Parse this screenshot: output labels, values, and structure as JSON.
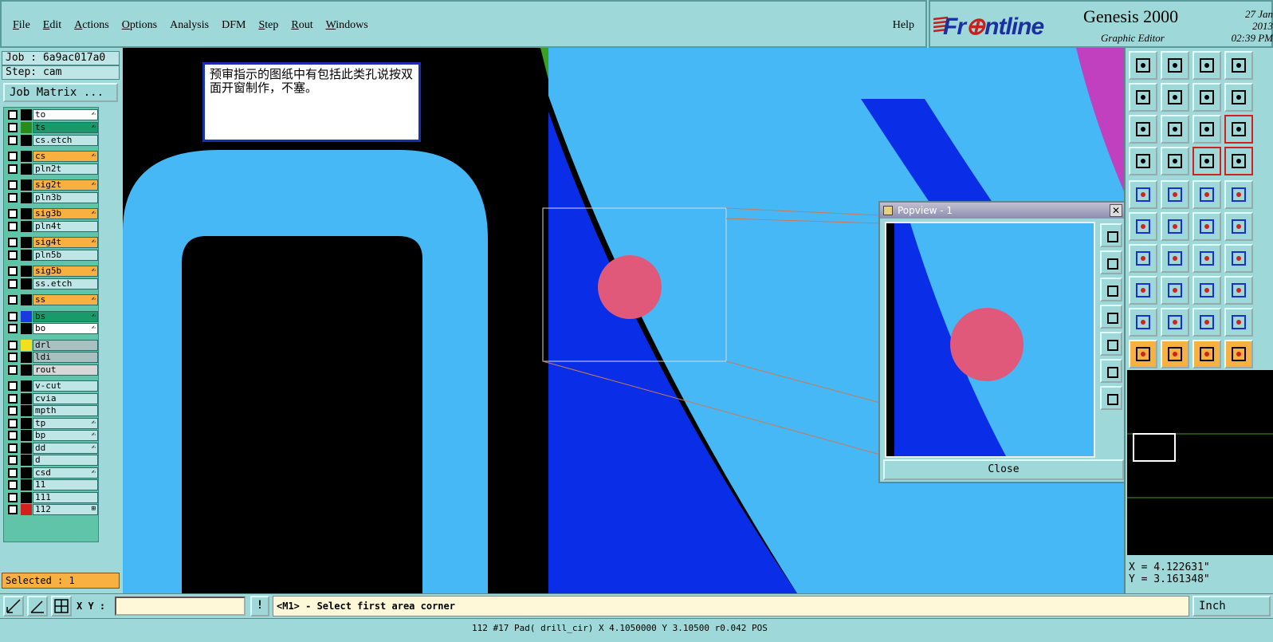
{
  "menu": {
    "items": [
      {
        "label": "File",
        "mnemonic": "F"
      },
      {
        "label": "Edit",
        "mnemonic": "E"
      },
      {
        "label": "Actions",
        "mnemonic": "A"
      },
      {
        "label": "Options",
        "mnemonic": "O"
      },
      {
        "label": "Analysis",
        "mnemonic": "A"
      },
      {
        "label": "DFM",
        "mnemonic": "D"
      },
      {
        "label": "Step",
        "mnemonic": "S"
      },
      {
        "label": "Rout",
        "mnemonic": "R"
      },
      {
        "label": "Windows",
        "mnemonic": "W"
      }
    ],
    "help": "Help"
  },
  "brand": {
    "logo_text_pre": "Fr",
    "logo_text_post": "ntline",
    "product": "Genesis 2000",
    "subtitle": "Graphic Editor",
    "date": "27 Jan 2013",
    "time": "02:39 PM"
  },
  "job": {
    "job_line": "Job : 6a9ac017a0",
    "step_line": "Step: cam",
    "job_matrix_button": "Job Matrix ..."
  },
  "layers": [
    {
      "name": "to",
      "style": "white",
      "color": "#000000",
      "mark": "✍"
    },
    {
      "name": "ts",
      "style": "green",
      "color": "#2a8a1a",
      "mark": "✍"
    },
    {
      "name": "cs.etch",
      "style": "plain",
      "color": "#000000",
      "mark": ""
    },
    {
      "name": "cs",
      "style": "orange",
      "color": "#000000",
      "mark": "✍"
    },
    {
      "name": "pln2t",
      "style": "plain",
      "color": "#000000",
      "mark": ""
    },
    {
      "name": "sig2t",
      "style": "orange",
      "color": "#000000",
      "mark": "✍"
    },
    {
      "name": "pln3b",
      "style": "plain",
      "color": "#000000",
      "mark": ""
    },
    {
      "name": "sig3b",
      "style": "orange",
      "color": "#000000",
      "mark": "✍"
    },
    {
      "name": "pln4t",
      "style": "plain",
      "color": "#000000",
      "mark": ""
    },
    {
      "name": "sig4t",
      "style": "orange",
      "color": "#000000",
      "mark": "✍"
    },
    {
      "name": "pln5b",
      "style": "plain",
      "color": "#000000",
      "mark": ""
    },
    {
      "name": "sig5b",
      "style": "orange",
      "color": "#000000",
      "mark": "✍"
    },
    {
      "name": "ss.etch",
      "style": "plain",
      "color": "#000000",
      "mark": ""
    },
    {
      "name": "ss",
      "style": "orange",
      "color": "#000000",
      "mark": "✍"
    },
    {
      "name": "bs",
      "style": "green",
      "color": "#1a3ae0",
      "mark": "✍"
    },
    {
      "name": "bo",
      "style": "white",
      "color": "#000000",
      "mark": "✍"
    },
    {
      "name": "drl",
      "style": "gray",
      "color": "#f0e020",
      "mark": ""
    },
    {
      "name": "ldi",
      "style": "gray",
      "color": "#000000",
      "mark": ""
    },
    {
      "name": "rout",
      "style": "lgray",
      "color": "#000000",
      "mark": ""
    },
    {
      "name": "v-cut",
      "style": "plain",
      "color": "#000000",
      "mark": ""
    },
    {
      "name": "cvia",
      "style": "plain",
      "color": "#000000",
      "mark": ""
    },
    {
      "name": "mpth",
      "style": "plain",
      "color": "#000000",
      "mark": ""
    },
    {
      "name": "tp",
      "style": "plain",
      "color": "#000000",
      "mark": "✍"
    },
    {
      "name": "bp",
      "style": "plain",
      "color": "#000000",
      "mark": "✍"
    },
    {
      "name": "dd",
      "style": "plain",
      "color": "#000000",
      "mark": "✍"
    },
    {
      "name": "d",
      "style": "plain",
      "color": "#000000",
      "mark": ""
    },
    {
      "name": "csd",
      "style": "plain",
      "color": "#000000",
      "mark": "✍"
    },
    {
      "name": "11",
      "style": "plain",
      "color": "#000000",
      "mark": ""
    },
    {
      "name": "111",
      "style": "plain",
      "color": "#000000",
      "mark": ""
    },
    {
      "name": "112",
      "style": "plain",
      "color": "#d02020",
      "mark": "⊞"
    }
  ],
  "selected": "Selected : 1",
  "note": "预审指示的图纸中有包括此类孔说按双面开窗制作，不塞。",
  "popview": {
    "title": "Popview - 1",
    "close_x": "✕",
    "close_button": "Close"
  },
  "coords": {
    "x": "X = 4.122631\"",
    "y": "Y = 3.161348\""
  },
  "bottom": {
    "xy_label": "X Y :",
    "xy_value": "",
    "bang": "!",
    "prompt": "<M1> - Select first area corner",
    "unit": "Inch"
  },
  "status_line": "112 #17 Pad( drill_cir) X 4.1050000 Y 3.10500 r0.042 POS",
  "colors": {
    "canvas_bg": "#000000",
    "copper_light": "#46b8f5",
    "copper_dark": "#0a2ee8",
    "pad": "#e0587a",
    "magenta": "#c040c0",
    "ui_bg": "#9ed8d8",
    "highlight": "#f8b040"
  }
}
